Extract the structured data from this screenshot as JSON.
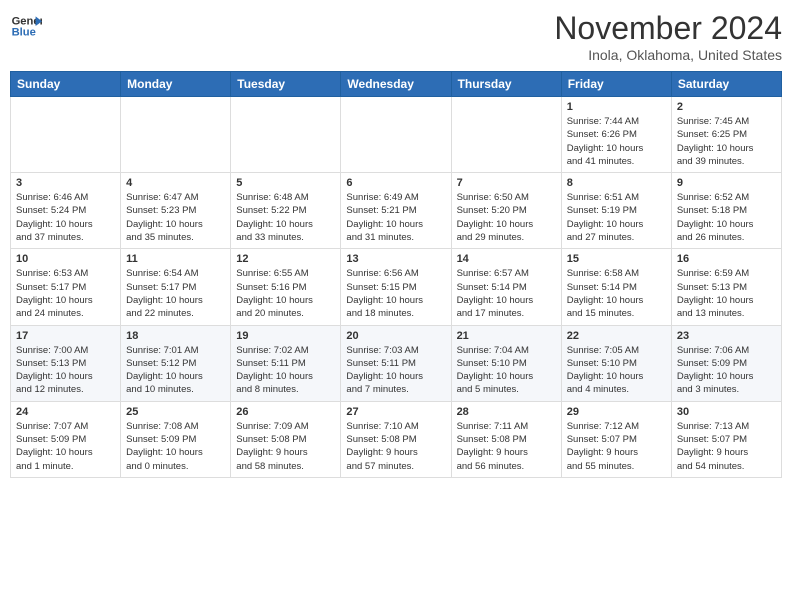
{
  "header": {
    "logo_general": "General",
    "logo_blue": "Blue",
    "month": "November 2024",
    "location": "Inola, Oklahoma, United States"
  },
  "weekdays": [
    "Sunday",
    "Monday",
    "Tuesday",
    "Wednesday",
    "Thursday",
    "Friday",
    "Saturday"
  ],
  "weeks": [
    [
      {
        "day": "",
        "info": ""
      },
      {
        "day": "",
        "info": ""
      },
      {
        "day": "",
        "info": ""
      },
      {
        "day": "",
        "info": ""
      },
      {
        "day": "",
        "info": ""
      },
      {
        "day": "1",
        "info": "Sunrise: 7:44 AM\nSunset: 6:26 PM\nDaylight: 10 hours\nand 41 minutes."
      },
      {
        "day": "2",
        "info": "Sunrise: 7:45 AM\nSunset: 6:25 PM\nDaylight: 10 hours\nand 39 minutes."
      }
    ],
    [
      {
        "day": "3",
        "info": "Sunrise: 6:46 AM\nSunset: 5:24 PM\nDaylight: 10 hours\nand 37 minutes."
      },
      {
        "day": "4",
        "info": "Sunrise: 6:47 AM\nSunset: 5:23 PM\nDaylight: 10 hours\nand 35 minutes."
      },
      {
        "day": "5",
        "info": "Sunrise: 6:48 AM\nSunset: 5:22 PM\nDaylight: 10 hours\nand 33 minutes."
      },
      {
        "day": "6",
        "info": "Sunrise: 6:49 AM\nSunset: 5:21 PM\nDaylight: 10 hours\nand 31 minutes."
      },
      {
        "day": "7",
        "info": "Sunrise: 6:50 AM\nSunset: 5:20 PM\nDaylight: 10 hours\nand 29 minutes."
      },
      {
        "day": "8",
        "info": "Sunrise: 6:51 AM\nSunset: 5:19 PM\nDaylight: 10 hours\nand 27 minutes."
      },
      {
        "day": "9",
        "info": "Sunrise: 6:52 AM\nSunset: 5:18 PM\nDaylight: 10 hours\nand 26 minutes."
      }
    ],
    [
      {
        "day": "10",
        "info": "Sunrise: 6:53 AM\nSunset: 5:17 PM\nDaylight: 10 hours\nand 24 minutes."
      },
      {
        "day": "11",
        "info": "Sunrise: 6:54 AM\nSunset: 5:17 PM\nDaylight: 10 hours\nand 22 minutes."
      },
      {
        "day": "12",
        "info": "Sunrise: 6:55 AM\nSunset: 5:16 PM\nDaylight: 10 hours\nand 20 minutes."
      },
      {
        "day": "13",
        "info": "Sunrise: 6:56 AM\nSunset: 5:15 PM\nDaylight: 10 hours\nand 18 minutes."
      },
      {
        "day": "14",
        "info": "Sunrise: 6:57 AM\nSunset: 5:14 PM\nDaylight: 10 hours\nand 17 minutes."
      },
      {
        "day": "15",
        "info": "Sunrise: 6:58 AM\nSunset: 5:14 PM\nDaylight: 10 hours\nand 15 minutes."
      },
      {
        "day": "16",
        "info": "Sunrise: 6:59 AM\nSunset: 5:13 PM\nDaylight: 10 hours\nand 13 minutes."
      }
    ],
    [
      {
        "day": "17",
        "info": "Sunrise: 7:00 AM\nSunset: 5:13 PM\nDaylight: 10 hours\nand 12 minutes."
      },
      {
        "day": "18",
        "info": "Sunrise: 7:01 AM\nSunset: 5:12 PM\nDaylight: 10 hours\nand 10 minutes."
      },
      {
        "day": "19",
        "info": "Sunrise: 7:02 AM\nSunset: 5:11 PM\nDaylight: 10 hours\nand 8 minutes."
      },
      {
        "day": "20",
        "info": "Sunrise: 7:03 AM\nSunset: 5:11 PM\nDaylight: 10 hours\nand 7 minutes."
      },
      {
        "day": "21",
        "info": "Sunrise: 7:04 AM\nSunset: 5:10 PM\nDaylight: 10 hours\nand 5 minutes."
      },
      {
        "day": "22",
        "info": "Sunrise: 7:05 AM\nSunset: 5:10 PM\nDaylight: 10 hours\nand 4 minutes."
      },
      {
        "day": "23",
        "info": "Sunrise: 7:06 AM\nSunset: 5:09 PM\nDaylight: 10 hours\nand 3 minutes."
      }
    ],
    [
      {
        "day": "24",
        "info": "Sunrise: 7:07 AM\nSunset: 5:09 PM\nDaylight: 10 hours\nand 1 minute."
      },
      {
        "day": "25",
        "info": "Sunrise: 7:08 AM\nSunset: 5:09 PM\nDaylight: 10 hours\nand 0 minutes."
      },
      {
        "day": "26",
        "info": "Sunrise: 7:09 AM\nSunset: 5:08 PM\nDaylight: 9 hours\nand 58 minutes."
      },
      {
        "day": "27",
        "info": "Sunrise: 7:10 AM\nSunset: 5:08 PM\nDaylight: 9 hours\nand 57 minutes."
      },
      {
        "day": "28",
        "info": "Sunrise: 7:11 AM\nSunset: 5:08 PM\nDaylight: 9 hours\nand 56 minutes."
      },
      {
        "day": "29",
        "info": "Sunrise: 7:12 AM\nSunset: 5:07 PM\nDaylight: 9 hours\nand 55 minutes."
      },
      {
        "day": "30",
        "info": "Sunrise: 7:13 AM\nSunset: 5:07 PM\nDaylight: 9 hours\nand 54 minutes."
      }
    ]
  ]
}
